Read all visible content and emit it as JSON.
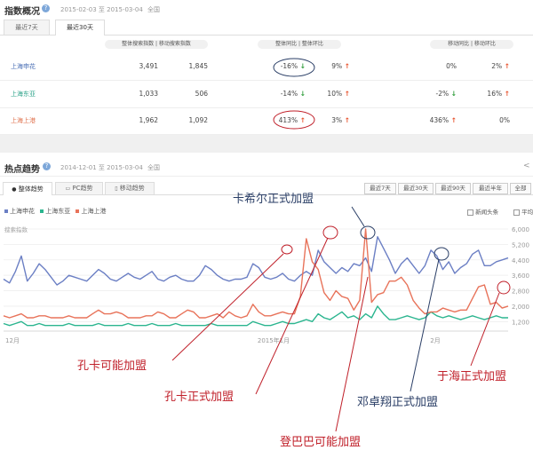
{
  "index_panel": {
    "title": "指数概况",
    "date_range": "2015-02-03 至 2015-03-04",
    "region": "全国",
    "tabs": [
      "最近7天",
      "最近30天"
    ],
    "header_pills": [
      "整体搜索指数 | 移动搜索指数",
      "整体同比 | 整体环比",
      "移动同比 | 移动环比"
    ],
    "rows": [
      {
        "name": "上海申花",
        "name_color": "#4a6fb5",
        "total": "3,491",
        "mobile": "1,845",
        "yoy": "-16%",
        "yoy_dir": "down",
        "mom": "9%",
        "mom_dir": "up",
        "m_yoy": "0%",
        "m_yoy_dir": "none",
        "m_mom": "2%",
        "m_mom_dir": "up"
      },
      {
        "name": "上海东亚",
        "name_color": "#2ea38a",
        "total": "1,033",
        "mobile": "506",
        "yoy": "-14%",
        "yoy_dir": "down",
        "mom": "10%",
        "mom_dir": "up",
        "m_yoy": "-2%",
        "m_yoy_dir": "down",
        "m_mom": "16%",
        "m_mom_dir": "up"
      },
      {
        "name": "上海上港",
        "name_color": "#e0734f",
        "total": "1,962",
        "mobile": "1,092",
        "yoy": "413%",
        "yoy_dir": "up",
        "mom": "3%",
        "mom_dir": "up",
        "m_yoy": "436%",
        "m_yoy_dir": "up",
        "m_mom": "0%",
        "m_mom_dir": "none"
      }
    ]
  },
  "trend_panel": {
    "title": "热点趋势",
    "date_range": "2014-12-01 至 2015-03-04",
    "region": "全国",
    "tabs": [
      "整体趋势",
      "PC趋势",
      "移动趋势"
    ],
    "range_buttons": [
      "最近7天",
      "最近30天",
      "最近90天",
      "最近半年",
      "全部"
    ],
    "legend": [
      {
        "name": "上海申花",
        "color": "#6b7fc4"
      },
      {
        "name": "上海东亚",
        "color": "#2bb58f"
      },
      {
        "name": "上海上港",
        "color": "#e8735a"
      }
    ],
    "checkboxes": [
      "新闻头条",
      "平均值"
    ],
    "y_label": "搜索指数",
    "icons": [
      "help-icon",
      "share-icon",
      "trend-icon",
      "pc-icon",
      "mobile-icon"
    ]
  },
  "chart_data": {
    "type": "line",
    "x": [
      "12月",
      "2015年1月",
      "2月"
    ],
    "y_ticks": [
      "6,000",
      "5,200",
      "4,400",
      "3,600",
      "2,800",
      "2,000",
      "1,200"
    ],
    "ylim": [
      800,
      6000
    ],
    "series": [
      {
        "name": "上海申花",
        "color": "#6b7fc4",
        "values": [
          3400,
          3200,
          3800,
          4600,
          3300,
          3700,
          4200,
          3900,
          3500,
          3100,
          3300,
          3600,
          3500,
          3400,
          3300,
          3600,
          3900,
          3700,
          3400,
          3300,
          3500,
          3700,
          3500,
          3400,
          3600,
          3800,
          3400,
          3300,
          3500,
          3600,
          3400,
          3300,
          3300,
          3600,
          4100,
          3900,
          3600,
          3400,
          3300,
          3400,
          3400,
          3500,
          4200,
          4000,
          3500,
          3400,
          3500,
          3700,
          3400,
          3300,
          3600,
          3800,
          3600,
          4900,
          4300,
          4000,
          3700,
          4000,
          3800,
          4200,
          4100,
          4500,
          3800,
          5600,
          5000,
          4400,
          3700,
          4200,
          4500,
          4100,
          3700,
          4100,
          4900,
          4600,
          3900,
          4300,
          3700,
          4000,
          4200,
          4700,
          4900,
          4100,
          4100,
          4300,
          4400,
          4500
        ]
      },
      {
        "name": "上海东亚",
        "color": "#2bb58f",
        "values": [
          1100,
          1000,
          1100,
          1200,
          1000,
          1000,
          1100,
          1000,
          1000,
          1000,
          1000,
          1100,
          1000,
          1000,
          1000,
          1000,
          1100,
          1000,
          1000,
          1000,
          1000,
          1100,
          1000,
          1000,
          1000,
          1100,
          1000,
          1000,
          1000,
          1100,
          1000,
          1000,
          1000,
          1000,
          1000,
          1100,
          1000,
          1000,
          1000,
          1000,
          1000,
          1000,
          1200,
          1100,
          1000,
          1000,
          1100,
          1200,
          1100,
          1100,
          1200,
          1300,
          1200,
          1600,
          1400,
          1300,
          1500,
          1700,
          1400,
          1500,
          1300,
          1600,
          1400,
          2000,
          1600,
          1300,
          1300,
          1400,
          1500,
          1400,
          1300,
          1400,
          1700,
          1500,
          1400,
          1500,
          1400,
          1300,
          1400,
          1500,
          1400,
          1300,
          1400,
          1500,
          1400,
          1400
        ]
      },
      {
        "name": "上海上港",
        "color": "#e8735a",
        "values": [
          1500,
          1400,
          1500,
          1600,
          1400,
          1400,
          1500,
          1500,
          1400,
          1400,
          1400,
          1500,
          1400,
          1400,
          1400,
          1600,
          1800,
          1600,
          1600,
          1700,
          1600,
          1400,
          1400,
          1400,
          1500,
          1500,
          1700,
          1600,
          1400,
          1400,
          1600,
          1800,
          1700,
          1400,
          1400,
          1500,
          1600,
          1400,
          1700,
          1500,
          1400,
          1500,
          2100,
          1700,
          1500,
          1500,
          1600,
          1700,
          1600,
          1600,
          2500,
          5500,
          4300,
          3900,
          2700,
          2300,
          2800,
          2500,
          2400,
          1800,
          2300,
          6000,
          2200,
          2600,
          2700,
          3300,
          3300,
          3500,
          3100,
          2300,
          1900,
          1600,
          1700,
          1700,
          1900,
          1800,
          1700,
          1800,
          1800,
          2400,
          3000,
          3100,
          2100,
          2200,
          1900,
          2000
        ]
      }
    ]
  },
  "annotations": [
    {
      "text": "卡希尔正式加盟",
      "color": "#2a3e66"
    },
    {
      "text": "孔卡可能加盟",
      "color": "#c0202a"
    },
    {
      "text": "孔卡正式加盟",
      "color": "#c0202a"
    },
    {
      "text": "邓卓翔正式加盟",
      "color": "#2a3e66"
    },
    {
      "text": "于海正式加盟",
      "color": "#c0202a"
    },
    {
      "text": "登巴巴可能加盟",
      "color": "#c0202a"
    }
  ]
}
